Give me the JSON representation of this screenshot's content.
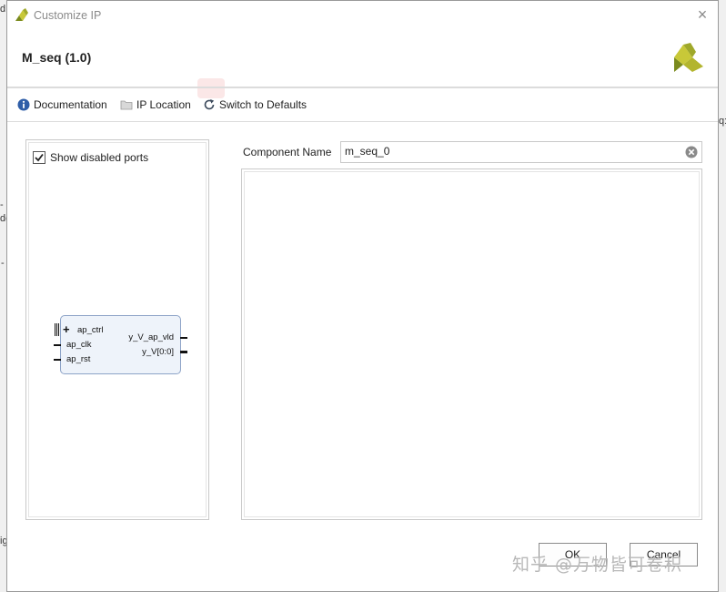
{
  "dialog": {
    "title": "Customize IP",
    "close_glyph": "×",
    "ip_title": "M_seq (1.0)"
  },
  "toolbar": {
    "documentation_label": "Documentation",
    "ip_location_label": "IP Location",
    "switch_defaults_label": "Switch to Defaults"
  },
  "left_panel": {
    "show_disabled_ports_label": "Show disabled ports",
    "show_disabled_ports_checked": true
  },
  "ip_block": {
    "left_ports": [
      "ap_ctrl",
      "ap_clk",
      "ap_rst"
    ],
    "right_ports": [
      "y_V_ap_vld",
      "y_V[0:0]"
    ],
    "expand_glyph": "+"
  },
  "component": {
    "label": "Component Name",
    "value": "m_seq_0"
  },
  "buttons": {
    "ok_label": "OK",
    "cancel_label": "Cancel"
  },
  "watermark": {
    "text": "知乎 @万物皆可卷积"
  },
  "background_fragments": {
    "f1": "d",
    "f2": "-",
    "f3": "de",
    "f4": "-",
    "f5": "q:",
    "f6": "ig"
  },
  "colors": {
    "ip_block_fill": "#eef3fa",
    "ip_block_border": "#8da3c7",
    "logo_green": "#c8c838",
    "logo_dark": "#7a8a1e",
    "info_icon_blue": "#2f5ea8"
  },
  "icons": {
    "title": "xilinx-logo-icon",
    "documentation": "info-icon",
    "ip_location": "folder-icon",
    "switch_defaults": "refresh-icon",
    "clear": "clear-icon"
  }
}
